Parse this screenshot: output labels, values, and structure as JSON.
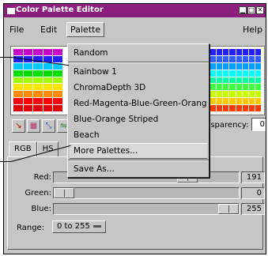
{
  "window": {
    "title": "Color Palette Editor",
    "icon": "window-menu-icon",
    "controls": [
      "minimize",
      "maximize",
      "close"
    ]
  },
  "menubar": {
    "file": "File",
    "edit": "Edit",
    "palette": "Palette",
    "help": "Help"
  },
  "palette_menu": {
    "items": [
      "Random",
      "Rainbow 1",
      "ChromaDepth 3D",
      "Red-Magenta-Blue-Green-Orange",
      "Blue-Orange Striped",
      "Beach",
      "More Palettes...",
      "Save As..."
    ]
  },
  "grid": {
    "left_rows": [
      [
        "#c800c8",
        "#c800c8",
        "#c800c8",
        "#c800c8",
        "#c800c8"
      ],
      [
        "#2020ff",
        "#2020ff",
        "#2020ff",
        "#2020ff",
        "#2020ff"
      ],
      [
        "#00c8ff",
        "#00c8ff",
        "#00c8ff",
        "#00c8ff",
        "#00c8ff"
      ],
      [
        "#00e000",
        "#00e000",
        "#00e000",
        "#00e000",
        "#00e000"
      ],
      [
        "#a0ff00",
        "#a0ff00",
        "#a0ff00",
        "#a0ff00",
        "#a0ff00"
      ],
      [
        "#ffe600",
        "#ffe600",
        "#ffe600",
        "#ffe600",
        "#ffe600"
      ],
      [
        "#ff8c00",
        "#ff8c00",
        "#ff8c00",
        "#ff8c00",
        "#ff8c00"
      ],
      [
        "#ff0000",
        "#ff0000",
        "#ff0000",
        "#ff0000",
        "#ff0000"
      ],
      [
        "#e00000",
        "#e00000",
        "#e00000",
        "#e00000",
        "#e00000"
      ]
    ],
    "right_rows": [
      [
        "#2020ff",
        "#2020ff",
        "#2020ff",
        "#2020ff",
        "#2020ff",
        "#2020ff",
        "#2020ff",
        "#2020ff"
      ],
      [
        "#3060ff",
        "#3060ff",
        "#3060ff",
        "#3060ff",
        "#3060ff",
        "#3060ff",
        "#3060ff",
        "#3060ff"
      ],
      [
        "#00a0ff",
        "#00a0ff",
        "#00a0ff",
        "#00a0ff",
        "#00a0ff",
        "#00a0ff",
        "#00a0ff",
        "#00a0ff"
      ],
      [
        "#00ffff",
        "#00ffff",
        "#00ffff",
        "#00ffff",
        "#00ffff",
        "#00ffff",
        "#00ffff",
        "#00ffff"
      ],
      [
        "#00ffa0",
        "#00ffa0",
        "#00ffa0",
        "#00ffa0",
        "#00ffa0",
        "#00ffa0",
        "#00ffa0",
        "#00ffa0"
      ],
      [
        "#40ff40",
        "#40ff40",
        "#40ff40",
        "#40ff40",
        "#40ff40",
        "#40ff40",
        "#40ff40",
        "#40ff40"
      ],
      [
        "#c8ff00",
        "#c8ff00",
        "#c8ff00",
        "#c8ff00",
        "#c8ff00",
        "#c8ff00",
        "#c8ff00",
        "#c8ff00"
      ],
      [
        "#ffc800",
        "#ffc800",
        "#ffc800",
        "#ffc800",
        "#ffc800",
        "#ffc800",
        "#ffc800",
        "#ffc800"
      ],
      [
        "#ff3c00",
        "#ff3c00",
        "#ff3c00",
        "#ff3c00",
        "#ff3c00",
        "#ff3c00",
        "#ff3c00",
        "#ff3c00"
      ]
    ]
  },
  "toolbar": {
    "tools": [
      {
        "icon": "pick-color-icon",
        "glyph": "↘",
        "color": "#cc0000"
      },
      {
        "icon": "spread-icon",
        "glyph": "▦",
        "color": "#aa3366"
      },
      {
        "icon": "interpolate-icon",
        "glyph": "⤡",
        "color": "#2255cc"
      },
      {
        "icon": "swap-icon",
        "glyph": "⇋",
        "color": "#228822"
      }
    ],
    "transparency_label": "nsparency:",
    "transparency_value": "0"
  },
  "tabs": {
    "rgb": "RGB",
    "hsv": "HS"
  },
  "sliders": [
    {
      "label": "Red:",
      "value": "191",
      "level": 0.75
    },
    {
      "label": "Green:",
      "value": "0",
      "level": 0
    },
    {
      "label": "Blue:",
      "value": "255",
      "level": 1
    }
  ],
  "range": {
    "label": "Range:",
    "value": "0 to 255"
  }
}
